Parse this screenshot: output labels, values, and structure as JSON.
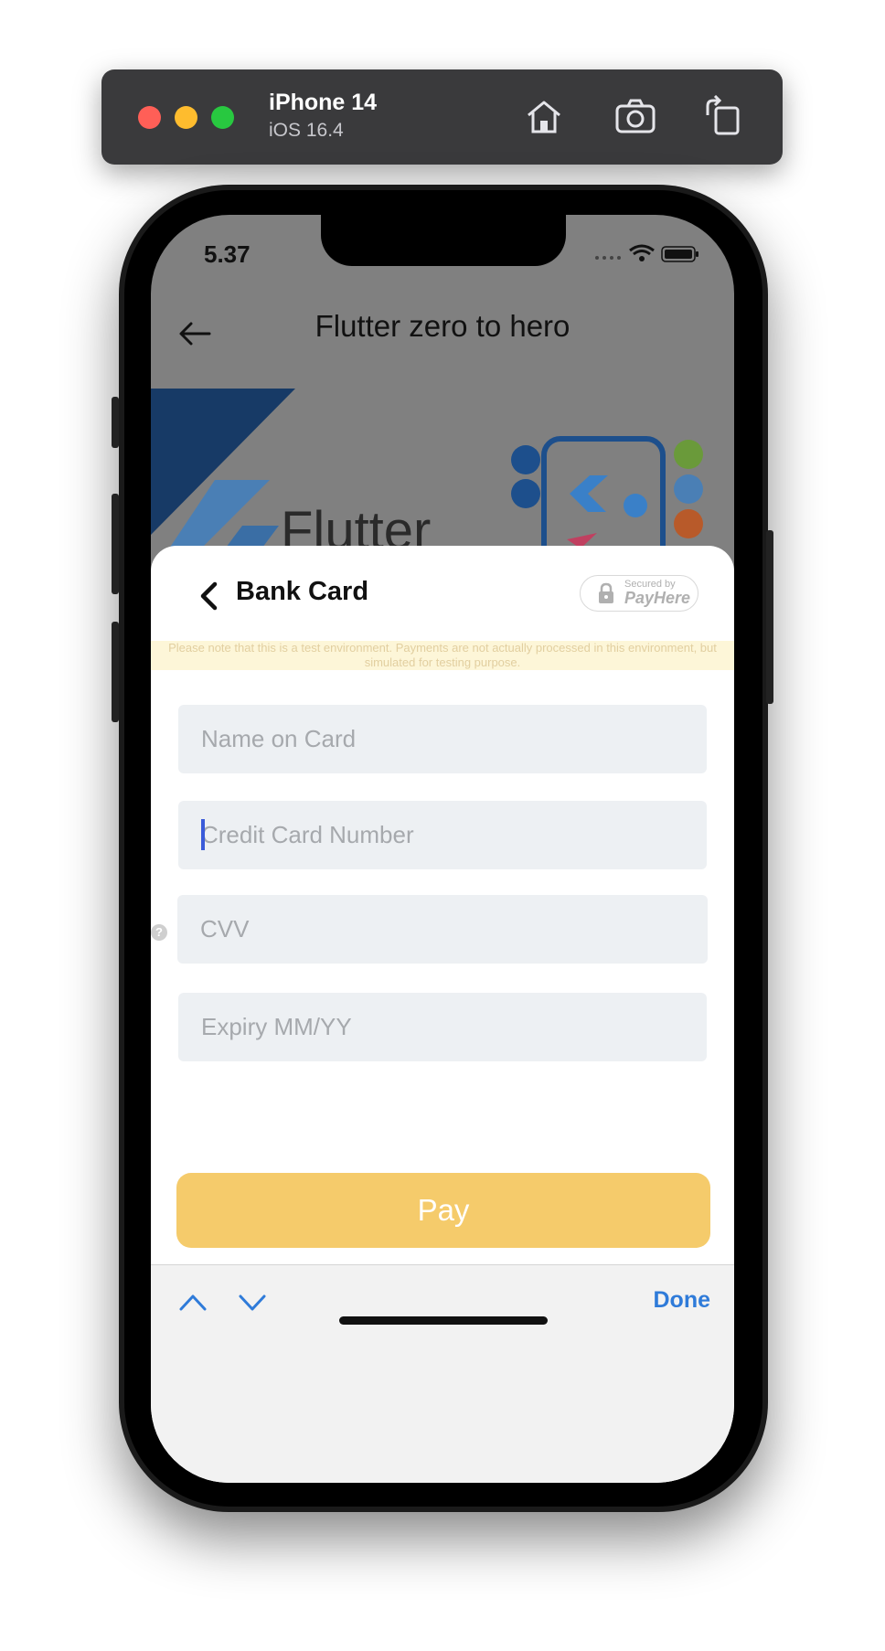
{
  "simulator": {
    "device": "iPhone 14",
    "os": "iOS 16.4",
    "buttons": [
      "home-icon",
      "screenshot-icon",
      "rotate-icon"
    ]
  },
  "status_bar": {
    "time": "5.37"
  },
  "app": {
    "title": "Flutter zero to hero"
  },
  "sheet": {
    "title": "Bank Card",
    "secured_small": "Secured by",
    "secured_brand": "PayHere",
    "notice": "Please note that this is a test environment. Payments are not actually processed in this environment, but simulated for testing purpose.",
    "fields": {
      "name": {
        "placeholder": "Name on Card",
        "value": ""
      },
      "card": {
        "placeholder": "Credit Card Number",
        "value": ""
      },
      "cvv": {
        "placeholder": "CVV",
        "value": ""
      },
      "expiry": {
        "placeholder": "Expiry MM/YY",
        "value": ""
      }
    },
    "cvv_help": "?",
    "pay_label": "Pay"
  },
  "keyboard_bar": {
    "done_label": "Done"
  },
  "colors": {
    "pay_button": "#f5cb6b",
    "done_text": "#2f7bd9",
    "field_bg": "#edf0f3",
    "notice_bg": "#fdf6d8"
  }
}
